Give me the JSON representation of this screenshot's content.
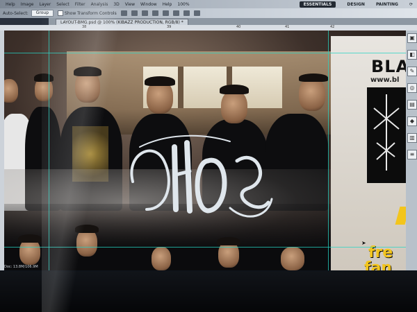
{
  "menu": {
    "items": [
      "Help",
      "Image",
      "Layer",
      "Select",
      "Filter",
      "Analysis",
      "3D",
      "View",
      "Window",
      "Help"
    ],
    "zoom": "100%",
    "workspaces": [
      "ESSENTIALS",
      "DESIGN",
      "PAINTING"
    ]
  },
  "options": {
    "auto_select_label": "Auto-Select:",
    "auto_select_value": "Group",
    "show_transform_label": "Show Transform Controls"
  },
  "document": {
    "tab_title": "LAYOUT-BMG.psd @ 100% (KIBAZZ PRODUCTION, RGB/8) *",
    "ruler_marks": [
      "38",
      "39",
      "40",
      "41",
      "42"
    ]
  },
  "artwork": {
    "right_title": "BLAS",
    "right_url": "www.bl",
    "promo_line1": "fre",
    "promo_line2": "fan",
    "status_text": "Doc: 13.8M/106.9M"
  },
  "colors": {
    "guide": "#26d4c4",
    "promo_yellow": "#f3c51c",
    "workspace_active_bg": "#232a33"
  }
}
